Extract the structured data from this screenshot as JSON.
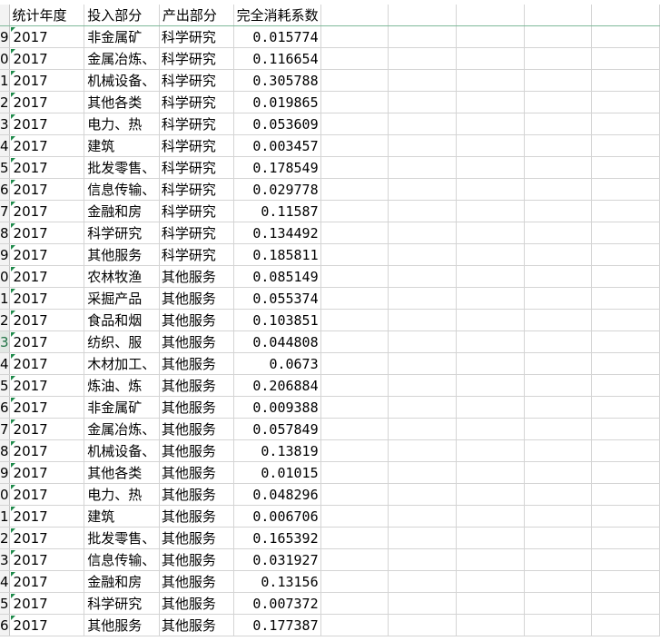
{
  "header": {
    "row_number": "",
    "col1": "统计年度",
    "col2": "投入部分",
    "col3": "产出部分",
    "col4": "完全消耗系数"
  },
  "rows": [
    {
      "rn": "9",
      "year": "2017",
      "input": "非金属矿",
      "output": "科学研究",
      "value": "0.015774"
    },
    {
      "rn": "0",
      "year": "2017",
      "input": "金属冶炼、",
      "output": "科学研究",
      "value": "0.116654"
    },
    {
      "rn": "1",
      "year": "2017",
      "input": "机械设备、",
      "output": "科学研究",
      "value": "0.305788"
    },
    {
      "rn": "2",
      "year": "2017",
      "input": "其他各类",
      "output": "科学研究",
      "value": "0.019865"
    },
    {
      "rn": "3",
      "year": "2017",
      "input": "电力、热",
      "output": "科学研究",
      "value": "0.053609"
    },
    {
      "rn": "4",
      "year": "2017",
      "input": "建筑",
      "output": "科学研究",
      "value": "0.003457"
    },
    {
      "rn": "5",
      "year": "2017",
      "input": "批发零售、",
      "output": "科学研究",
      "value": "0.178549"
    },
    {
      "rn": "6",
      "year": "2017",
      "input": "信息传输、",
      "output": "科学研究",
      "value": "0.029778"
    },
    {
      "rn": "7",
      "year": "2017",
      "input": "金融和房",
      "output": "科学研究",
      "value": "0.11587"
    },
    {
      "rn": "8",
      "year": "2017",
      "input": "科学研究",
      "output": "科学研究",
      "value": "0.134492"
    },
    {
      "rn": "9",
      "year": "2017",
      "input": "其他服务",
      "output": "科学研究",
      "value": "0.185811"
    },
    {
      "rn": "0",
      "year": "2017",
      "input": "农林牧渔",
      "output": "其他服务",
      "value": "0.085149"
    },
    {
      "rn": "1",
      "year": "2017",
      "input": "采掘产品",
      "output": "其他服务",
      "value": "0.055374"
    },
    {
      "rn": "2",
      "year": "2017",
      "input": "食品和烟",
      "output": "其他服务",
      "value": "0.103851"
    },
    {
      "rn": "3",
      "year": "2017",
      "input": "纺织、服",
      "output": "其他服务",
      "value": "0.044808"
    },
    {
      "rn": "4",
      "year": "2017",
      "input": "木材加工、",
      "output": "其他服务",
      "value": "0.0673"
    },
    {
      "rn": "5",
      "year": "2017",
      "input": "炼油、炼",
      "output": "其他服务",
      "value": "0.206884"
    },
    {
      "rn": "6",
      "year": "2017",
      "input": "非金属矿",
      "output": "其他服务",
      "value": "0.009388"
    },
    {
      "rn": "7",
      "year": "2017",
      "input": "金属冶炼、",
      "output": "其他服务",
      "value": "0.057849"
    },
    {
      "rn": "8",
      "year": "2017",
      "input": "机械设备、",
      "output": "其他服务",
      "value": "0.13819"
    },
    {
      "rn": "9",
      "year": "2017",
      "input": "其他各类",
      "output": "其他服务",
      "value": "0.01015"
    },
    {
      "rn": "0",
      "year": "2017",
      "input": "电力、热",
      "output": "其他服务",
      "value": "0.048296"
    },
    {
      "rn": "1",
      "year": "2017",
      "input": "建筑",
      "output": "其他服务",
      "value": "0.006706"
    },
    {
      "rn": "2",
      "year": "2017",
      "input": "批发零售、",
      "output": "其他服务",
      "value": "0.165392"
    },
    {
      "rn": "3",
      "year": "2017",
      "input": "信息传输、",
      "output": "其他服务",
      "value": "0.031927"
    },
    {
      "rn": "4",
      "year": "2017",
      "input": "金融和房",
      "output": "其他服务",
      "value": "0.13156"
    },
    {
      "rn": "5",
      "year": "2017",
      "input": "科学研究",
      "output": "其他服务",
      "value": "0.007372"
    },
    {
      "rn": "6",
      "year": "2017",
      "input": "其他服务",
      "output": "其他服务",
      "value": "0.177387"
    }
  ],
  "active_row_index": 14
}
